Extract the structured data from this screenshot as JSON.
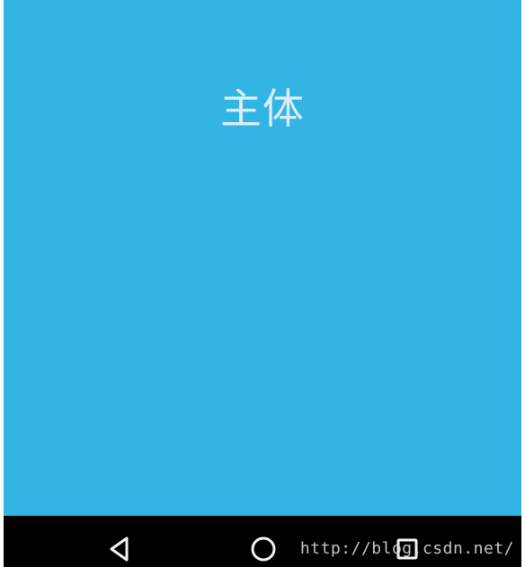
{
  "screen": {
    "main_title": "主体",
    "background_color": "#32b5e5",
    "title_color": "#dcecf6"
  },
  "navigation_bar": {
    "background_color": "#000000",
    "icons": [
      "back-icon",
      "home-icon",
      "recent-apps-icon"
    ]
  },
  "watermark": {
    "text": "http://blog.csdn.net/"
  }
}
